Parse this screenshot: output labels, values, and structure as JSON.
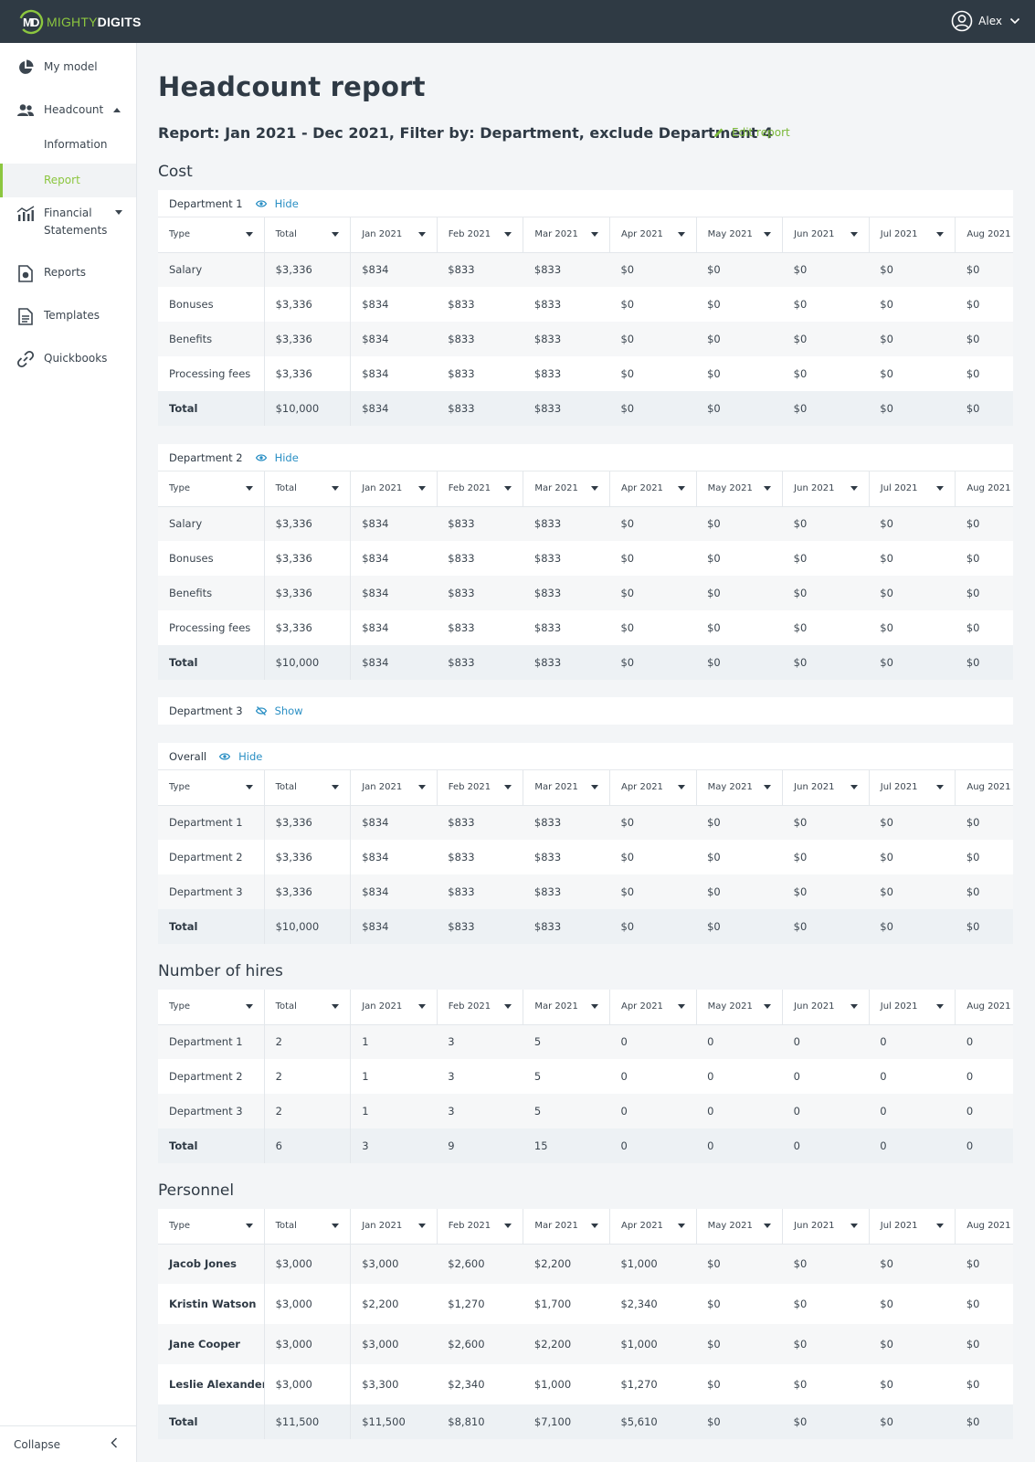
{
  "app": {
    "logo_part1": "MIGHTY",
    "logo_part2": "DIGITS",
    "user": "Alex"
  },
  "sidebar": {
    "my_model": "My model",
    "headcount": "Headcount",
    "information": "Information",
    "report": "Report",
    "financial1": "Financial",
    "financial2": "Statements",
    "reports": "Reports",
    "templates": "Templates",
    "quickbooks": "Quickbooks",
    "collapse": "Collapse"
  },
  "page": {
    "title": "Headcount report",
    "subtitle": "Report: Jan 2021 - Dec 2021, Filter by: Department, exclude Department 4",
    "edit": "Edit report"
  },
  "headers": [
    "Type",
    "Total",
    "Jan 2021",
    "Feb 2021",
    "Mar 2021",
    "Apr 2021",
    "May 2021",
    "Jun 2021",
    "Jul 2021",
    "Aug 2021"
  ],
  "sections": {
    "cost": "Cost",
    "hires": "Number of hires",
    "personnel": "Personnel"
  },
  "toggles": {
    "hide": "Hide",
    "show": "Show"
  },
  "dept1": {
    "name": "Department 1",
    "rows": [
      [
        "Salary",
        "$3,336",
        "$834",
        "$833",
        "$833",
        "$0",
        "$0",
        "$0",
        "$0",
        "$0"
      ],
      [
        "Bonuses",
        "$3,336",
        "$834",
        "$833",
        "$833",
        "$0",
        "$0",
        "$0",
        "$0",
        "$0"
      ],
      [
        "Benefits",
        "$3,336",
        "$834",
        "$833",
        "$833",
        "$0",
        "$0",
        "$0",
        "$0",
        "$0"
      ],
      [
        "Processing fees",
        "$3,336",
        "$834",
        "$833",
        "$833",
        "$0",
        "$0",
        "$0",
        "$0",
        "$0"
      ],
      [
        "Total",
        "$10,000",
        "$834",
        "$833",
        "$833",
        "$0",
        "$0",
        "$0",
        "$0",
        "$0"
      ]
    ]
  },
  "dept2": {
    "name": "Department 2",
    "rows": [
      [
        "Salary",
        "$3,336",
        "$834",
        "$833",
        "$833",
        "$0",
        "$0",
        "$0",
        "$0",
        "$0"
      ],
      [
        "Bonuses",
        "$3,336",
        "$834",
        "$833",
        "$833",
        "$0",
        "$0",
        "$0",
        "$0",
        "$0"
      ],
      [
        "Benefits",
        "$3,336",
        "$834",
        "$833",
        "$833",
        "$0",
        "$0",
        "$0",
        "$0",
        "$0"
      ],
      [
        "Processing fees",
        "$3,336",
        "$834",
        "$833",
        "$833",
        "$0",
        "$0",
        "$0",
        "$0",
        "$0"
      ],
      [
        "Total",
        "$10,000",
        "$834",
        "$833",
        "$833",
        "$0",
        "$0",
        "$0",
        "$0",
        "$0"
      ]
    ]
  },
  "dept3": {
    "name": "Department 3"
  },
  "overall": {
    "name": "Overall",
    "rows": [
      [
        "Department 1",
        "$3,336",
        "$834",
        "$833",
        "$833",
        "$0",
        "$0",
        "$0",
        "$0",
        "$0"
      ],
      [
        "Department 2",
        "$3,336",
        "$834",
        "$833",
        "$833",
        "$0",
        "$0",
        "$0",
        "$0",
        "$0"
      ],
      [
        "Department 3",
        "$3,336",
        "$834",
        "$833",
        "$833",
        "$0",
        "$0",
        "$0",
        "$0",
        "$0"
      ],
      [
        "Total",
        "$10,000",
        "$834",
        "$833",
        "$833",
        "$0",
        "$0",
        "$0",
        "$0",
        "$0"
      ]
    ]
  },
  "hires": {
    "rows": [
      [
        "Department 1",
        "2",
        "1",
        "3",
        "5",
        "0",
        "0",
        "0",
        "0",
        "0"
      ],
      [
        "Department 2",
        "2",
        "1",
        "3",
        "5",
        "0",
        "0",
        "0",
        "0",
        "0"
      ],
      [
        "Department 3",
        "2",
        "1",
        "3",
        "5",
        "0",
        "0",
        "0",
        "0",
        "0"
      ],
      [
        "Total",
        "6",
        "3",
        "9",
        "15",
        "0",
        "0",
        "0",
        "0",
        "0"
      ]
    ]
  },
  "personnel": {
    "rows": [
      [
        "Jacob Jones",
        "$3,000",
        "$3,000",
        "$2,600",
        "$2,200",
        "$1,000",
        "$0",
        "$0",
        "$0",
        "$0"
      ],
      [
        "Kristin Watson",
        "$3,000",
        "$2,200",
        "$1,270",
        "$1,700",
        "$2,340",
        "$0",
        "$0",
        "$0",
        "$0"
      ],
      [
        "Jane Cooper",
        "$3,000",
        "$3,000",
        "$2,600",
        "$2,200",
        "$1,000",
        "$0",
        "$0",
        "$0",
        "$0"
      ],
      [
        "Leslie Alexander",
        "$3,000",
        "$3,300",
        "$2,340",
        "$1,000",
        "$1,270",
        "$0",
        "$0",
        "$0",
        "$0"
      ],
      [
        "Total",
        "$11,500",
        "$11,500",
        "$8,810",
        "$7,100",
        "$5,610",
        "$0",
        "$0",
        "$0",
        "$0"
      ]
    ]
  }
}
